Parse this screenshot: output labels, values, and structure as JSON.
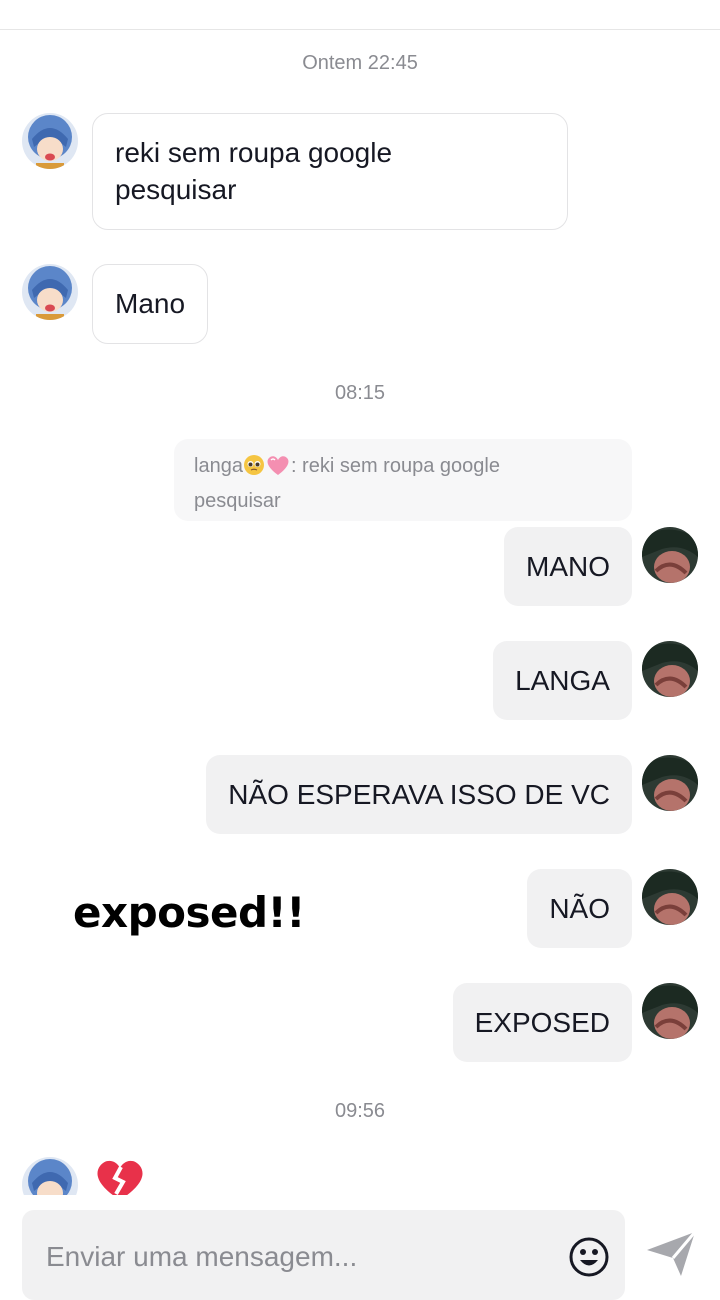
{
  "chat": {
    "timestamps": [
      "Ontem 22:45",
      "08:15",
      "09:56"
    ],
    "incoming": [
      {
        "text": "reki sem roupa google\npesquisar"
      },
      {
        "text": "Mano"
      }
    ],
    "reply_quote": {
      "author": "langa",
      "emoji": [
        "pleading-face",
        "pink-heart"
      ],
      "text": ": reki sem roupa google\npesquisar"
    },
    "outgoing": [
      "MANO",
      "LANGA",
      "NÃO ESPERAVA ISSO DE VC",
      "NÃO",
      "EXPOSED"
    ],
    "last_incoming_icon": "broken-heart-icon"
  },
  "overlay": {
    "text": "exposed!!"
  },
  "composer": {
    "placeholder": "Enviar uma mensagem..."
  },
  "colors": {
    "bubble_out": "#f1f1f2",
    "timestamp": "#8a8b91",
    "broken_heart": "#e8314a"
  }
}
